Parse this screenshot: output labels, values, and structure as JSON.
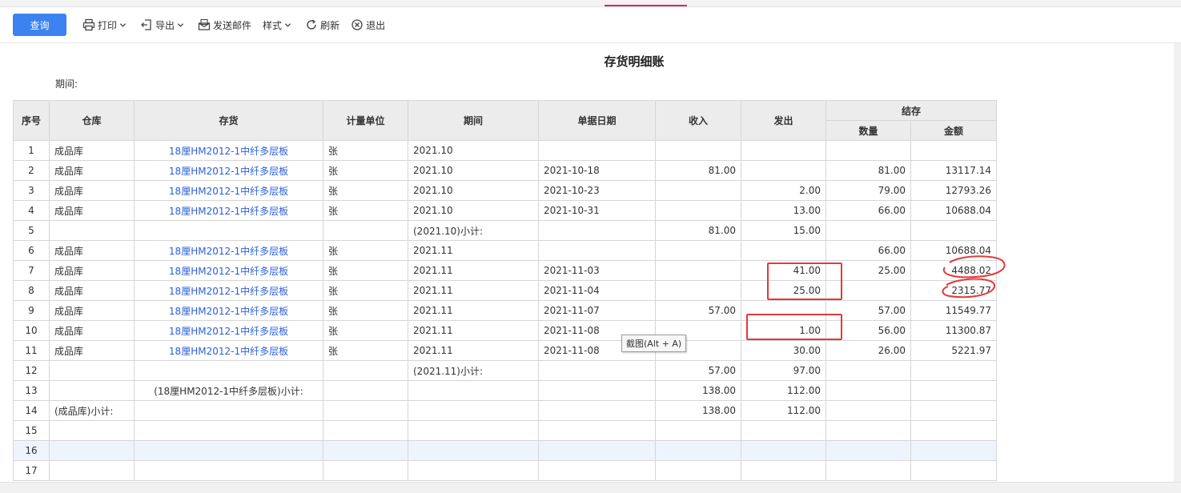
{
  "toolbar": {
    "query_label": "查询",
    "print_label": "打印",
    "export_label": "导出",
    "email_label": "发送邮件",
    "style_label": "样式",
    "refresh_label": "刷新",
    "exit_label": "退出"
  },
  "report": {
    "title": "存货明细账",
    "period_label": "期间:"
  },
  "table": {
    "headers": {
      "seq": "序号",
      "warehouse": "仓库",
      "inventory": "存货",
      "unit": "计量单位",
      "period": "期间",
      "doc_date": "单据日期",
      "income": "收入",
      "issue": "发出",
      "balance": "结存",
      "qty": "数量",
      "amount": "金额"
    },
    "rows": [
      {
        "seq": "1",
        "warehouse": "成品库",
        "inventory": "18厘HM2012-1中纤多层板",
        "unit": "张",
        "period": "2021.10",
        "date": "",
        "income": "",
        "issue": "",
        "qty": "",
        "amount": ""
      },
      {
        "seq": "2",
        "warehouse": "成品库",
        "inventory": "18厘HM2012-1中纤多层板",
        "unit": "张",
        "period": "2021.10",
        "date": "2021-10-18",
        "income": "81.00",
        "issue": "",
        "qty": "81.00",
        "amount": "13117.14"
      },
      {
        "seq": "3",
        "warehouse": "成品库",
        "inventory": "18厘HM2012-1中纤多层板",
        "unit": "张",
        "period": "2021.10",
        "date": "2021-10-23",
        "income": "",
        "issue": "2.00",
        "qty": "79.00",
        "amount": "12793.26"
      },
      {
        "seq": "4",
        "warehouse": "成品库",
        "inventory": "18厘HM2012-1中纤多层板",
        "unit": "张",
        "period": "2021.10",
        "date": "2021-10-31",
        "income": "",
        "issue": "13.00",
        "qty": "66.00",
        "amount": "10688.04"
      },
      {
        "seq": "5",
        "warehouse": "",
        "inventory": "",
        "unit": "",
        "period": "(2021.10)小计:",
        "date": "",
        "income": "81.00",
        "issue": "15.00",
        "qty": "",
        "amount": ""
      },
      {
        "seq": "6",
        "warehouse": "成品库",
        "inventory": "18厘HM2012-1中纤多层板",
        "unit": "张",
        "period": "2021.11",
        "date": "",
        "income": "",
        "issue": "",
        "qty": "66.00",
        "amount": "10688.04"
      },
      {
        "seq": "7",
        "warehouse": "成品库",
        "inventory": "18厘HM2012-1中纤多层板",
        "unit": "张",
        "period": "2021.11",
        "date": "2021-11-03",
        "income": "",
        "issue": "41.00",
        "qty": "25.00",
        "amount": "4488.02"
      },
      {
        "seq": "8",
        "warehouse": "成品库",
        "inventory": "18厘HM2012-1中纤多层板",
        "unit": "张",
        "period": "2021.11",
        "date": "2021-11-04",
        "income": "",
        "issue": "25.00",
        "qty": "",
        "amount": "2315.77"
      },
      {
        "seq": "9",
        "warehouse": "成品库",
        "inventory": "18厘HM2012-1中纤多层板",
        "unit": "张",
        "period": "2021.11",
        "date": "2021-11-07",
        "income": "57.00",
        "issue": "",
        "qty": "57.00",
        "amount": "11549.77"
      },
      {
        "seq": "10",
        "warehouse": "成品库",
        "inventory": "18厘HM2012-1中纤多层板",
        "unit": "张",
        "period": "2021.11",
        "date": "2021-11-08",
        "income": "",
        "issue": "1.00",
        "qty": "56.00",
        "amount": "11300.87"
      },
      {
        "seq": "11",
        "warehouse": "成品库",
        "inventory": "18厘HM2012-1中纤多层板",
        "unit": "张",
        "period": "2021.11",
        "date": "2021-11-08",
        "income": "",
        "issue": "30.00",
        "qty": "26.00",
        "amount": "5221.97"
      },
      {
        "seq": "12",
        "warehouse": "",
        "inventory": "",
        "unit": "",
        "period": "(2021.11)小计:",
        "date": "",
        "income": "57.00",
        "issue": "97.00",
        "qty": "",
        "amount": ""
      },
      {
        "seq": "13",
        "warehouse": "",
        "inventory": "(18厘HM2012-1中纤多层板)小计:",
        "unit": "",
        "period": "",
        "date": "",
        "income": "138.00",
        "issue": "112.00",
        "qty": "",
        "amount": ""
      },
      {
        "seq": "14",
        "warehouse": "(成品库)小计:",
        "inventory": "",
        "unit": "",
        "period": "",
        "date": "",
        "income": "138.00",
        "issue": "112.00",
        "qty": "",
        "amount": ""
      },
      {
        "seq": "15",
        "warehouse": "",
        "inventory": "",
        "unit": "",
        "period": "",
        "date": "",
        "income": "",
        "issue": "",
        "qty": "",
        "amount": ""
      },
      {
        "seq": "16",
        "warehouse": "",
        "inventory": "",
        "unit": "",
        "period": "",
        "date": "",
        "income": "",
        "issue": "",
        "qty": "",
        "amount": ""
      },
      {
        "seq": "17",
        "warehouse": "",
        "inventory": "",
        "unit": "",
        "period": "",
        "date": "",
        "income": "",
        "issue": "",
        "qty": "",
        "amount": ""
      }
    ]
  },
  "tooltip": {
    "text": "截图(Alt + A)"
  },
  "colors": {
    "primary": "#3c82f0",
    "link": "#2b5fd9",
    "annotation": "#e23a3a",
    "active_tab": "#e0245e"
  }
}
